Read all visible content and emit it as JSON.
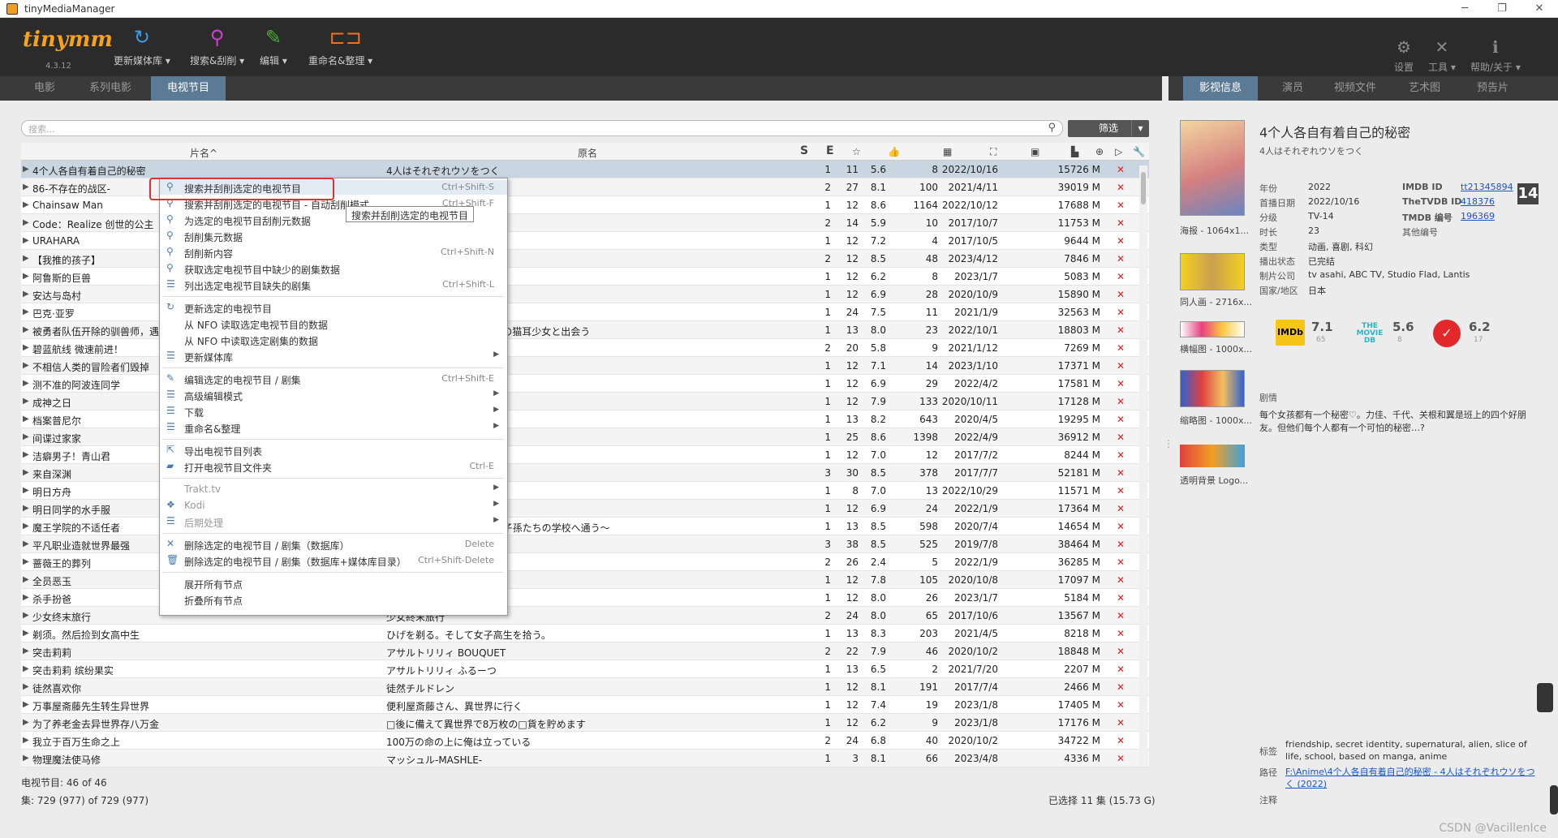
{
  "window": {
    "title": "tinyMediaManager"
  },
  "toolbar": {
    "logo": "tinymm",
    "version": "4.3.12",
    "update_library": "更新媒体库 ▾",
    "search_scrape": "搜索&刮削 ▾",
    "edit": "编辑 ▾",
    "rename": "重命名&整理 ▾",
    "settings": "设置",
    "tools": "工具 ▾",
    "help": "帮助/关于 ▾"
  },
  "tabs": [
    "电影",
    "系列电影",
    "电视节目"
  ],
  "right_tabs": [
    "影视信息",
    "演员",
    "视频文件",
    "艺术图",
    "预告片"
  ],
  "search": {
    "placeholder": "搜索..."
  },
  "filter": {
    "label": "筛选"
  },
  "columns": {
    "title": "片名^",
    "original": "原名",
    "s": "S",
    "e": "E"
  },
  "rows": [
    {
      "title": "4个人各自有着自己的秘密",
      "orig": "4人はそれぞれウソをつく",
      "s": "1",
      "e": "11",
      "r": "5.6",
      "v": "8",
      "d": "2022/10/16",
      "sz": "15726 M"
    },
    {
      "title": "86-不存在的战区-",
      "orig": "",
      "s": "2",
      "e": "27",
      "r": "8.1",
      "v": "100",
      "d": "2021/4/11",
      "sz": "39019 M"
    },
    {
      "title": "Chainsaw Man",
      "orig": "",
      "s": "1",
      "e": "12",
      "r": "8.6",
      "v": "1164",
      "d": "2022/10/12",
      "sz": "17688 M"
    },
    {
      "title": "Code：Realize 创世的公主",
      "orig": "",
      "s": "2",
      "e": "14",
      "r": "5.9",
      "v": "10",
      "d": "2017/10/7",
      "sz": "11753 M"
    },
    {
      "title": "URAHARA",
      "orig": "",
      "s": "1",
      "e": "12",
      "r": "7.2",
      "v": "4",
      "d": "2017/10/5",
      "sz": "9644 M"
    },
    {
      "title": "【我推的孩子】",
      "orig": "",
      "s": "2",
      "e": "12",
      "r": "8.5",
      "v": "48",
      "d": "2023/4/12",
      "sz": "7846 M"
    },
    {
      "title": "阿鲁斯的巨兽",
      "orig": "",
      "s": "1",
      "e": "12",
      "r": "6.2",
      "v": "8",
      "d": "2023/1/7",
      "sz": "5083 M"
    },
    {
      "title": "安达与岛村",
      "orig": "",
      "s": "1",
      "e": "12",
      "r": "6.9",
      "v": "28",
      "d": "2020/10/9",
      "sz": "15890 M"
    },
    {
      "title": "巴克·亚罗",
      "orig": "",
      "s": "1",
      "e": "24",
      "r": "7.5",
      "v": "11",
      "d": "2021/1/9",
      "sz": "32563 M"
    },
    {
      "title": "被勇者队伍开除的驯兽师，遇",
      "orig": "ビーストテイマー、最強種の猫耳少女と出会う",
      "s": "1",
      "e": "13",
      "r": "8.0",
      "v": "23",
      "d": "2022/10/1",
      "sz": "18803 M"
    },
    {
      "title": "碧蓝航线 微速前进！",
      "orig": "んっ!",
      "s": "2",
      "e": "20",
      "r": "5.8",
      "v": "9",
      "d": "2021/1/12",
      "sz": "7269 M"
    },
    {
      "title": "不相信人类的冒险者们毁掉",
      "orig": "を救うようです",
      "s": "1",
      "e": "12",
      "r": "7.1",
      "v": "14",
      "d": "2023/1/10",
      "sz": "17371 M"
    },
    {
      "title": "测不准的阿波连同学",
      "orig": "",
      "s": "1",
      "e": "12",
      "r": "6.9",
      "v": "29",
      "d": "2022/4/2",
      "sz": "17581 M"
    },
    {
      "title": "成神之日",
      "orig": "",
      "s": "1",
      "e": "12",
      "r": "7.9",
      "v": "133",
      "d": "2020/10/11",
      "sz": "17128 M"
    },
    {
      "title": "档案普尼尔",
      "orig": "",
      "s": "1",
      "e": "13",
      "r": "8.2",
      "v": "643",
      "d": "2020/4/5",
      "sz": "19295 M"
    },
    {
      "title": "间谍过家家",
      "orig": "",
      "s": "1",
      "e": "25",
      "r": "8.6",
      "v": "1398",
      "d": "2022/4/9",
      "sz": "36912 M"
    },
    {
      "title": "洁癖男子！青山君",
      "orig": "",
      "s": "1",
      "e": "12",
      "r": "7.0",
      "v": "12",
      "d": "2017/7/2",
      "sz": "8244 M"
    },
    {
      "title": "来自深渊",
      "orig": "",
      "s": "3",
      "e": "30",
      "r": "8.5",
      "v": "378",
      "d": "2017/7/7",
      "sz": "52181 M"
    },
    {
      "title": "明日方舟",
      "orig": "",
      "s": "1",
      "e": "8",
      "r": "7.0",
      "v": "13",
      "d": "2022/10/29",
      "sz": "11571 M"
    },
    {
      "title": "明日同学的水手服",
      "orig": "",
      "s": "1",
      "e": "12",
      "r": "6.9",
      "v": "24",
      "d": "2022/1/9",
      "sz": "17364 M"
    },
    {
      "title": "魔王学院的不适任者",
      "orig": "強の魔王の始祖、転生して子孫たちの学校へ通う～",
      "s": "1",
      "e": "13",
      "r": "8.5",
      "v": "598",
      "d": "2020/7/4",
      "sz": "14654 M"
    },
    {
      "title": "平凡职业造就世界最强",
      "orig": "",
      "s": "3",
      "e": "38",
      "r": "8.5",
      "v": "525",
      "d": "2019/7/8",
      "sz": "38464 M"
    },
    {
      "title": "蔷薇王的葬列",
      "orig": "",
      "s": "2",
      "e": "26",
      "r": "2.4",
      "v": "5",
      "d": "2022/1/9",
      "sz": "36285 M"
    },
    {
      "title": "全员恶玉",
      "orig": "",
      "s": "1",
      "e": "12",
      "r": "7.8",
      "v": "105",
      "d": "2020/10/8",
      "sz": "17097 M"
    },
    {
      "title": "杀手扮爸",
      "orig": "",
      "s": "1",
      "e": "12",
      "r": "8.0",
      "v": "26",
      "d": "2023/1/7",
      "sz": "5184 M"
    },
    {
      "title": "少女终末旅行",
      "orig": "少女終末旅行",
      "s": "2",
      "e": "24",
      "r": "8.0",
      "v": "65",
      "d": "2017/10/6",
      "sz": "13567 M"
    },
    {
      "title": "剃须。然后捡到女高中生",
      "orig": "ひげを剃る。そして女子高生を拾う。",
      "s": "1",
      "e": "13",
      "r": "8.3",
      "v": "203",
      "d": "2021/4/5",
      "sz": "8218 M"
    },
    {
      "title": "突击莉莉",
      "orig": "アサルトリリィ BOUQUET",
      "s": "2",
      "e": "22",
      "r": "7.9",
      "v": "46",
      "d": "2020/10/2",
      "sz": "18848 M"
    },
    {
      "title": "突击莉莉 缤纷果实",
      "orig": "アサルトリリィ ふるーつ",
      "s": "1",
      "e": "13",
      "r": "6.5",
      "v": "2",
      "d": "2021/7/20",
      "sz": "2207 M"
    },
    {
      "title": "徒然喜欢你",
      "orig": "徒然チルドレン",
      "s": "1",
      "e": "12",
      "r": "8.1",
      "v": "191",
      "d": "2017/7/4",
      "sz": "2466 M"
    },
    {
      "title": "万事屋斋藤先生转生异世界",
      "orig": "便利屋斎藤さん、異世界に行く",
      "s": "1",
      "e": "12",
      "r": "7.4",
      "v": "19",
      "d": "2023/1/8",
      "sz": "17405 M"
    },
    {
      "title": "为了养老金去异世界存八万金",
      "orig": "□後に備えて異世界で8万枚の□貨を貯めます",
      "s": "1",
      "e": "12",
      "r": "6.2",
      "v": "9",
      "d": "2023/1/8",
      "sz": "17176 M"
    },
    {
      "title": "我立于百万生命之上",
      "orig": "100万の命の上に俺は立っている",
      "s": "2",
      "e": "24",
      "r": "6.8",
      "v": "40",
      "d": "2020/10/2",
      "sz": "34722 M"
    },
    {
      "title": "物理魔法使马修",
      "orig": "マッシュル-MASHLE-",
      "s": "1",
      "e": "3",
      "r": "8.1",
      "v": "66",
      "d": "2023/4/8",
      "sz": "4336 M"
    }
  ],
  "status": {
    "shows": "电视节目:  46  of  46",
    "episodes": "集:  729 (977)  of  729 (977)",
    "selected": "已选择 11 集 (15.73 G)"
  },
  "context_menu": [
    {
      "label": "搜索并刮削选定的电视节目",
      "shortcut": "Ctrl+Shift-S",
      "icon": "search-icon"
    },
    {
      "label": "搜索并刮削选定的电视节目 - 自动刮削模式",
      "shortcut": "Ctrl+Shift-F",
      "icon": "search-icon"
    },
    {
      "label": "为选定的电视节目刮削元数据",
      "shortcut": "",
      "icon": "search-icon"
    },
    {
      "label": "刮削集元数据",
      "shortcut": "",
      "icon": "search-icon"
    },
    {
      "label": "刮削新内容",
      "shortcut": "Ctrl+Shift-N",
      "icon": "search-icon"
    },
    {
      "label": "获取选定电视节目中缺少的剧集数据",
      "shortcut": "",
      "icon": "search-icon"
    },
    {
      "label": "列出选定电视节目缺失的剧集",
      "shortcut": "Ctrl+Shift-L",
      "icon": "list-icon"
    },
    {
      "label": "更新选定的电视节目",
      "shortcut": "",
      "icon": "refresh-icon"
    },
    {
      "label": "从 NFO 读取选定电视节目的数据",
      "shortcut": "",
      "icon": ""
    },
    {
      "label": "从 NFO 中读取选定剧集的数据",
      "shortcut": "",
      "icon": ""
    },
    {
      "label": "更新媒体库",
      "shortcut": "",
      "icon": "list-icon",
      "submenu": true
    },
    {
      "label": "编辑选定的电视节目 / 剧集",
      "shortcut": "Ctrl+Shift-E",
      "icon": "edit-icon"
    },
    {
      "label": "高级编辑模式",
      "shortcut": "",
      "icon": "list-icon",
      "submenu": true
    },
    {
      "label": "下载",
      "shortcut": "",
      "icon": "list-icon",
      "submenu": true
    },
    {
      "label": "重命名&整理",
      "shortcut": "",
      "icon": "list-icon",
      "submenu": true
    },
    {
      "label": "导出电视节目列表",
      "shortcut": "",
      "icon": "export-icon"
    },
    {
      "label": "打开电视节目文件夹",
      "shortcut": "Ctrl-E",
      "icon": "folder-icon"
    },
    {
      "label": "Trakt.tv",
      "shortcut": "",
      "icon": "",
      "submenu": true,
      "disabled": true
    },
    {
      "label": "Kodi",
      "shortcut": "",
      "icon": "kodi-icon",
      "submenu": true,
      "disabled": true
    },
    {
      "label": "后期处理",
      "shortcut": "",
      "icon": "list-icon",
      "submenu": true,
      "disabled": true
    },
    {
      "label": "删除选定的电视节目 / 剧集（数据库）",
      "shortcut": "Delete",
      "icon": "close-icon"
    },
    {
      "label": "删除选定的电视节目 / 剧集（数据库+媒体库目录）",
      "shortcut": "Ctrl+Shift-Delete",
      "icon": "trash-icon"
    },
    {
      "label": "展开所有节点",
      "shortcut": "",
      "icon": ""
    },
    {
      "label": "折叠所有节点",
      "shortcut": "",
      "icon": ""
    }
  ],
  "tooltip": "搜索并刮削选定的电视节目",
  "detail": {
    "title": "4个人各自有着自己的秘密",
    "original": "4人はそれぞれウソをつく",
    "age_badge": "14",
    "year_k": "年份",
    "year_v": "2022",
    "aired_k": "首播日期",
    "aired_v": "2022/10/16",
    "cert_k": "分级",
    "cert_v": "TV-14",
    "runtime_k": "时长",
    "runtime_v": "23",
    "genre_k": "类型",
    "genre_v": "动画, 喜剧, 科幻",
    "status_k": "播出状态",
    "status_v": "已完结",
    "studio_k": "制片公司",
    "studio_v": "tv asahi, ABC TV, Studio Flad, Lantis",
    "country_k": "国家/地区",
    "country_v": "日本",
    "imdb_k": "IMDB ID",
    "imdb_v": "tt21345894",
    "tvdb_k": "TheTVDB ID",
    "tvdb_v": "418376",
    "tmdb_k": "TMDB 编号",
    "tmdb_v": "196369",
    "other_k": "其他编号",
    "imdb_score": "7.1",
    "imdb_votes": "65",
    "tmdb_score": "5.6",
    "tmdb_votes": "8",
    "trakt_score": "6.2",
    "trakt_votes": "17",
    "plot_k": "剧情",
    "plot_v": "每个女孩都有一个秘密♡。力佳、千代、关根和翼是班上的四个好朋友。但他们每个人都有一个可怕的秘密…?",
    "tags_k": "标签",
    "tags_v": "friendship, secret identity, supernatural, alien, slice of life, school, based on manga, anime",
    "path_k": "路径",
    "path_v": "F:\\Anime\\4个人各自有着自己的秘密 - 4人はそれぞれウソをつく (2022)",
    "note_k": "注释"
  },
  "artwork_labels": [
    "海报 - 1064x1...",
    "同人画 - 2716x...",
    "横幅图 - 1000x...",
    "缩略图 - 1000x...",
    "透明背景 Logo..."
  ],
  "watermark": "CSDN @VacillenIce"
}
